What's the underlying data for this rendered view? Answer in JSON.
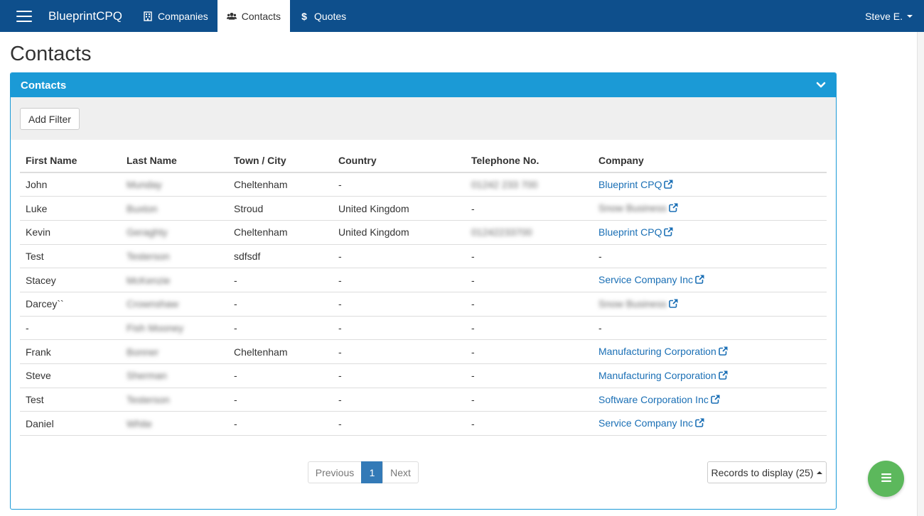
{
  "app": {
    "brand": "BlueprintCPQ",
    "nav": [
      {
        "label": "Companies",
        "icon": "building-icon"
      },
      {
        "label": "Contacts",
        "icon": "users-icon",
        "active": true
      },
      {
        "label": "Quotes",
        "icon": "dollar-icon"
      }
    ],
    "user": "Steve E."
  },
  "page": {
    "title": "Contacts"
  },
  "panel": {
    "title": "Contacts",
    "add_filter_label": "Add Filter"
  },
  "table": {
    "columns": [
      "First Name",
      "Last Name",
      "Town / City",
      "Country",
      "Telephone No.",
      "Company"
    ],
    "rows": [
      {
        "first": "John",
        "last": "Munday",
        "town": "Cheltenham",
        "country": "-",
        "phone": "01242 233 700",
        "company": "Blueprint CPQ"
      },
      {
        "first": "Luke",
        "last": "Buxton",
        "town": "Stroud",
        "country": "United Kingdom",
        "phone": "-",
        "company": "Snow Business"
      },
      {
        "first": "Kevin",
        "last": "Geraghty",
        "town": "Cheltenham",
        "country": "United Kingdom",
        "phone": "01242233700",
        "company": "Blueprint CPQ"
      },
      {
        "first": "Test",
        "last": "Testerson",
        "town": "sdfsdf",
        "country": "-",
        "phone": "-",
        "company": "-"
      },
      {
        "first": "Stacey",
        "last": "McKenzie",
        "town": "-",
        "country": "-",
        "phone": "-",
        "company": "Service Company Inc"
      },
      {
        "first": "Darcey``",
        "last": "Crownshaw",
        "town": "-",
        "country": "-",
        "phone": "-",
        "company": "Snow Business"
      },
      {
        "first": "-",
        "last": "Fish Mooney",
        "town": "-",
        "country": "-",
        "phone": "-",
        "company": "-"
      },
      {
        "first": "Frank",
        "last": "Bonner",
        "town": "Cheltenham",
        "country": "-",
        "phone": "-",
        "company": "Manufacturing Corporation"
      },
      {
        "first": "Steve",
        "last": "Sherman",
        "town": "-",
        "country": "-",
        "phone": "-",
        "company": "Manufacturing Corporation"
      },
      {
        "first": "Test",
        "last": "Testerson",
        "town": "-",
        "country": "-",
        "phone": "-",
        "company": "Software Corporation Inc"
      },
      {
        "first": "Daniel",
        "last": "White",
        "town": "-",
        "country": "-",
        "phone": "-",
        "company": "Service Company Inc"
      }
    ]
  },
  "pagination": {
    "previous": "Previous",
    "current_page": "1",
    "next": "Next",
    "records_label": "Records to display (25)"
  },
  "colors": {
    "navbar": "#0e4f8c",
    "panel_header": "#1b9ad6",
    "link": "#1a6fb5",
    "active_page": "#337ab7",
    "fab": "#5cb85c"
  }
}
